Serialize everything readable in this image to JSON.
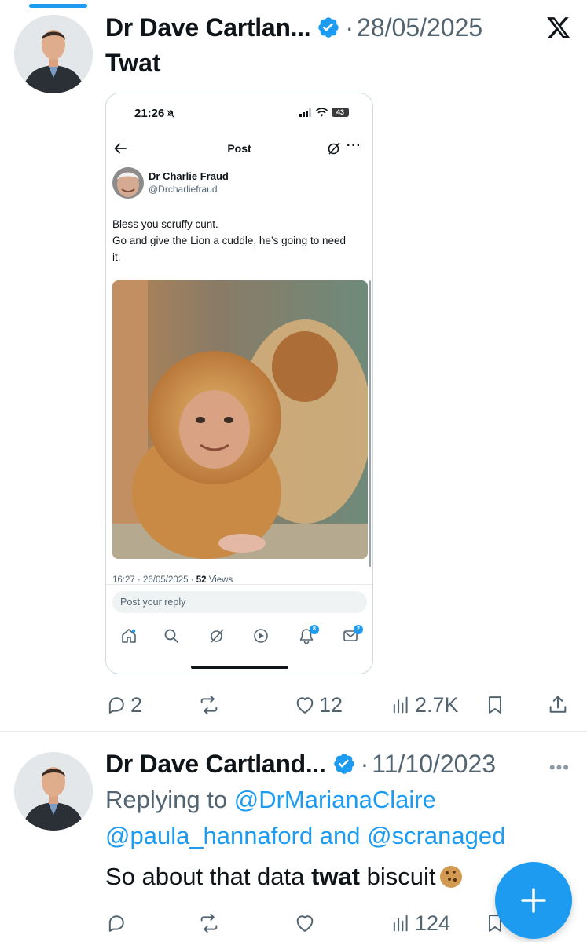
{
  "tweets": [
    {
      "author": "Dr Dave Cartlan...",
      "separator": "·",
      "date": "28/05/2025",
      "text": "Twat",
      "embedded": {
        "status_time": "21:26",
        "battery": "43",
        "nav_title": "Post",
        "inner_name": "Dr Charlie Fraud",
        "inner_handle": "@Drcharliefraud",
        "inner_text_line1": "Bless you scruffy cunt.",
        "inner_text_line2": "Go and give the Lion a cuddle, he’s going to need it.",
        "meta_time": "16:27 · 26/05/2025 · ",
        "meta_views": "52",
        "meta_views_label": " Views",
        "reply_placeholder": "Post your reply",
        "notifications_badge": "8",
        "messages_badge": "2"
      },
      "actions": {
        "replies": "2",
        "reposts": "",
        "likes": "12",
        "views": "2.7K"
      }
    },
    {
      "author": "Dr Dave Cartland...",
      "separator": "·",
      "date": "11/10/2023",
      "reply_prefix": "Replying to ",
      "reply_mention_1": "@DrMarianaClaire",
      "reply_mention_2": "@paula_hannaford",
      "reply_and": " and ",
      "reply_mention_3": "@scranaged",
      "text_before": "So about that data ",
      "text_bold": "twat",
      "text_after": " biscuit",
      "actions": {
        "replies": "",
        "reposts": "",
        "likes": "",
        "views": "124"
      }
    }
  ],
  "icons": {
    "verified": "verified-badge-icon",
    "x_logo": "x-logo-icon",
    "fab": "plus-icon"
  },
  "colors": {
    "accent": "#1d9bf0",
    "text": "#0f1419",
    "muted": "#536471"
  }
}
